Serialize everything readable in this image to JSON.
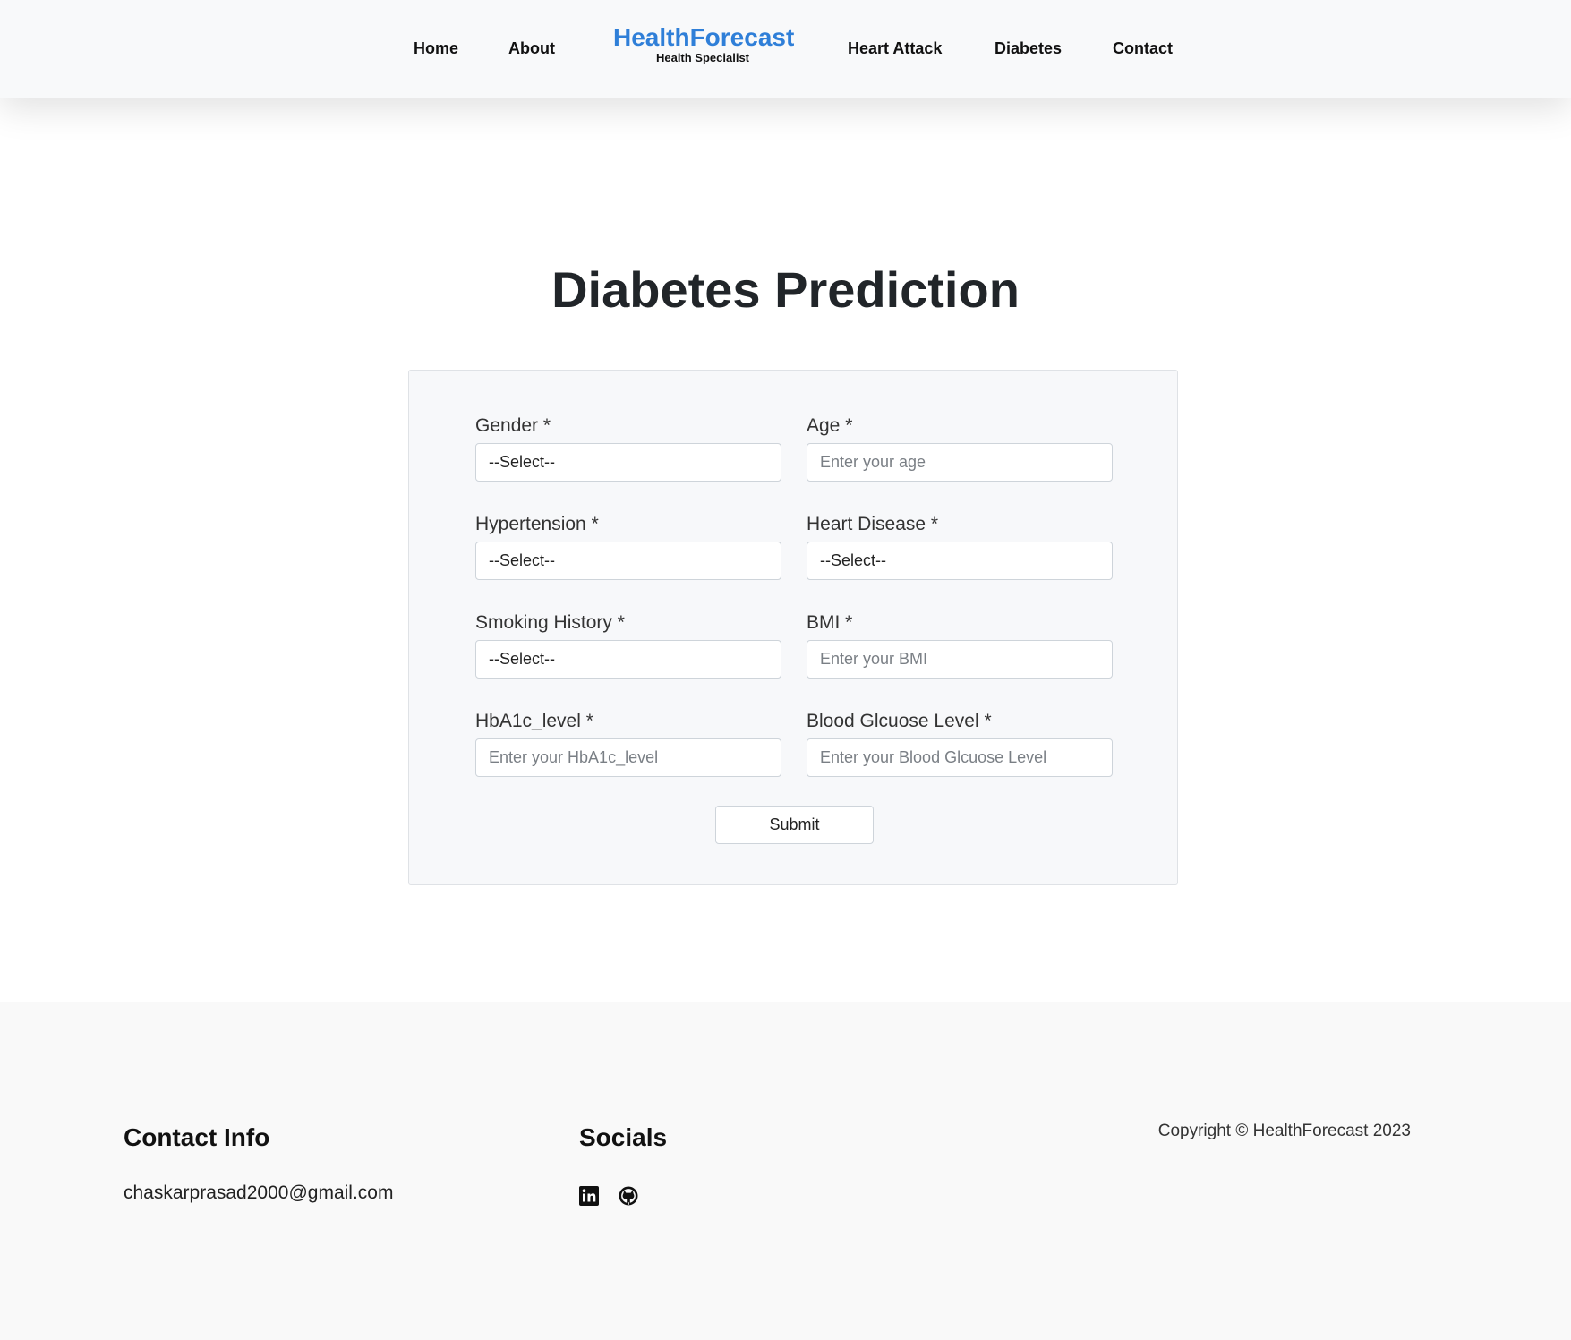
{
  "nav": {
    "links_left": [
      "Home",
      "About"
    ],
    "brand_title": "HealthForecast",
    "brand_subtitle": "Health Specialist",
    "links_right": [
      "Heart Attack",
      "Diabetes",
      "Contact"
    ]
  },
  "page_title": "Diabetes Prediction",
  "form": {
    "gender": {
      "label": "Gender *",
      "value": "--Select--"
    },
    "age": {
      "label": "Age *",
      "placeholder": "Enter your age"
    },
    "hypertension": {
      "label": "Hypertension *",
      "value": "--Select--"
    },
    "heart_disease": {
      "label": "Heart Disease *",
      "value": "--Select--"
    },
    "smoking_history": {
      "label": "Smoking History *",
      "value": "--Select--"
    },
    "bmi": {
      "label": "BMI *",
      "placeholder": "Enter your BMI"
    },
    "hba1c": {
      "label": "HbA1c_level *",
      "placeholder": "Enter your HbA1c_level"
    },
    "blood_glucose": {
      "label": "Blood Glcuose Level *",
      "placeholder": "Enter your Blood Glcuose Level"
    },
    "submit_label": "Submit"
  },
  "footer": {
    "contact_heading": "Contact Info",
    "email": "chaskarprasad2000@gmail.com",
    "socials_heading": "Socials",
    "social_icons": [
      "linkedin-icon",
      "github-icon"
    ],
    "copyright": "Copyright © HealthForecast 2023"
  },
  "colors": {
    "brand": "#2f7fd8",
    "nav_background": "#f8f9fa",
    "footer_background": "#f9f9f9",
    "form_background": "#f7f8fa"
  }
}
